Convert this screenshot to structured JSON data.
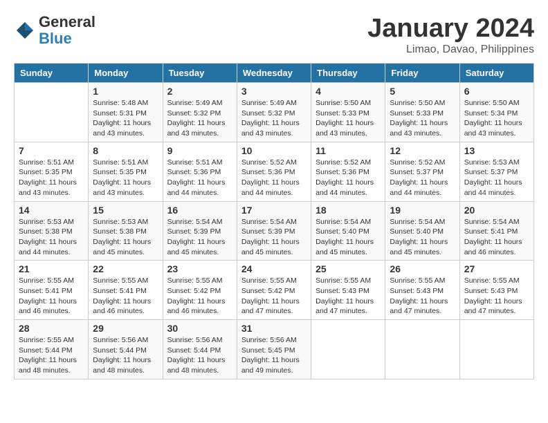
{
  "logo": {
    "line1": "General",
    "line2": "Blue"
  },
  "title": "January 2024",
  "subtitle": "Limao, Davao, Philippines",
  "days_of_week": [
    "Sunday",
    "Monday",
    "Tuesday",
    "Wednesday",
    "Thursday",
    "Friday",
    "Saturday"
  ],
  "weeks": [
    [
      {
        "day": "",
        "info": ""
      },
      {
        "day": "1",
        "info": "Sunrise: 5:48 AM\nSunset: 5:31 PM\nDaylight: 11 hours\nand 43 minutes."
      },
      {
        "day": "2",
        "info": "Sunrise: 5:49 AM\nSunset: 5:32 PM\nDaylight: 11 hours\nand 43 minutes."
      },
      {
        "day": "3",
        "info": "Sunrise: 5:49 AM\nSunset: 5:32 PM\nDaylight: 11 hours\nand 43 minutes."
      },
      {
        "day": "4",
        "info": "Sunrise: 5:50 AM\nSunset: 5:33 PM\nDaylight: 11 hours\nand 43 minutes."
      },
      {
        "day": "5",
        "info": "Sunrise: 5:50 AM\nSunset: 5:33 PM\nDaylight: 11 hours\nand 43 minutes."
      },
      {
        "day": "6",
        "info": "Sunrise: 5:50 AM\nSunset: 5:34 PM\nDaylight: 11 hours\nand 43 minutes."
      }
    ],
    [
      {
        "day": "7",
        "info": "Sunrise: 5:51 AM\nSunset: 5:35 PM\nDaylight: 11 hours\nand 43 minutes."
      },
      {
        "day": "8",
        "info": "Sunrise: 5:51 AM\nSunset: 5:35 PM\nDaylight: 11 hours\nand 43 minutes."
      },
      {
        "day": "9",
        "info": "Sunrise: 5:51 AM\nSunset: 5:36 PM\nDaylight: 11 hours\nand 44 minutes."
      },
      {
        "day": "10",
        "info": "Sunrise: 5:52 AM\nSunset: 5:36 PM\nDaylight: 11 hours\nand 44 minutes."
      },
      {
        "day": "11",
        "info": "Sunrise: 5:52 AM\nSunset: 5:36 PM\nDaylight: 11 hours\nand 44 minutes."
      },
      {
        "day": "12",
        "info": "Sunrise: 5:52 AM\nSunset: 5:37 PM\nDaylight: 11 hours\nand 44 minutes."
      },
      {
        "day": "13",
        "info": "Sunrise: 5:53 AM\nSunset: 5:37 PM\nDaylight: 11 hours\nand 44 minutes."
      }
    ],
    [
      {
        "day": "14",
        "info": "Sunrise: 5:53 AM\nSunset: 5:38 PM\nDaylight: 11 hours\nand 44 minutes."
      },
      {
        "day": "15",
        "info": "Sunrise: 5:53 AM\nSunset: 5:38 PM\nDaylight: 11 hours\nand 45 minutes."
      },
      {
        "day": "16",
        "info": "Sunrise: 5:54 AM\nSunset: 5:39 PM\nDaylight: 11 hours\nand 45 minutes."
      },
      {
        "day": "17",
        "info": "Sunrise: 5:54 AM\nSunset: 5:39 PM\nDaylight: 11 hours\nand 45 minutes."
      },
      {
        "day": "18",
        "info": "Sunrise: 5:54 AM\nSunset: 5:40 PM\nDaylight: 11 hours\nand 45 minutes."
      },
      {
        "day": "19",
        "info": "Sunrise: 5:54 AM\nSunset: 5:40 PM\nDaylight: 11 hours\nand 45 minutes."
      },
      {
        "day": "20",
        "info": "Sunrise: 5:54 AM\nSunset: 5:41 PM\nDaylight: 11 hours\nand 46 minutes."
      }
    ],
    [
      {
        "day": "21",
        "info": "Sunrise: 5:55 AM\nSunset: 5:41 PM\nDaylight: 11 hours\nand 46 minutes."
      },
      {
        "day": "22",
        "info": "Sunrise: 5:55 AM\nSunset: 5:41 PM\nDaylight: 11 hours\nand 46 minutes."
      },
      {
        "day": "23",
        "info": "Sunrise: 5:55 AM\nSunset: 5:42 PM\nDaylight: 11 hours\nand 46 minutes."
      },
      {
        "day": "24",
        "info": "Sunrise: 5:55 AM\nSunset: 5:42 PM\nDaylight: 11 hours\nand 47 minutes."
      },
      {
        "day": "25",
        "info": "Sunrise: 5:55 AM\nSunset: 5:43 PM\nDaylight: 11 hours\nand 47 minutes."
      },
      {
        "day": "26",
        "info": "Sunrise: 5:55 AM\nSunset: 5:43 PM\nDaylight: 11 hours\nand 47 minutes."
      },
      {
        "day": "27",
        "info": "Sunrise: 5:55 AM\nSunset: 5:43 PM\nDaylight: 11 hours\nand 47 minutes."
      }
    ],
    [
      {
        "day": "28",
        "info": "Sunrise: 5:55 AM\nSunset: 5:44 PM\nDaylight: 11 hours\nand 48 minutes."
      },
      {
        "day": "29",
        "info": "Sunrise: 5:56 AM\nSunset: 5:44 PM\nDaylight: 11 hours\nand 48 minutes."
      },
      {
        "day": "30",
        "info": "Sunrise: 5:56 AM\nSunset: 5:44 PM\nDaylight: 11 hours\nand 48 minutes."
      },
      {
        "day": "31",
        "info": "Sunrise: 5:56 AM\nSunset: 5:45 PM\nDaylight: 11 hours\nand 49 minutes."
      },
      {
        "day": "",
        "info": ""
      },
      {
        "day": "",
        "info": ""
      },
      {
        "day": "",
        "info": ""
      }
    ]
  ]
}
